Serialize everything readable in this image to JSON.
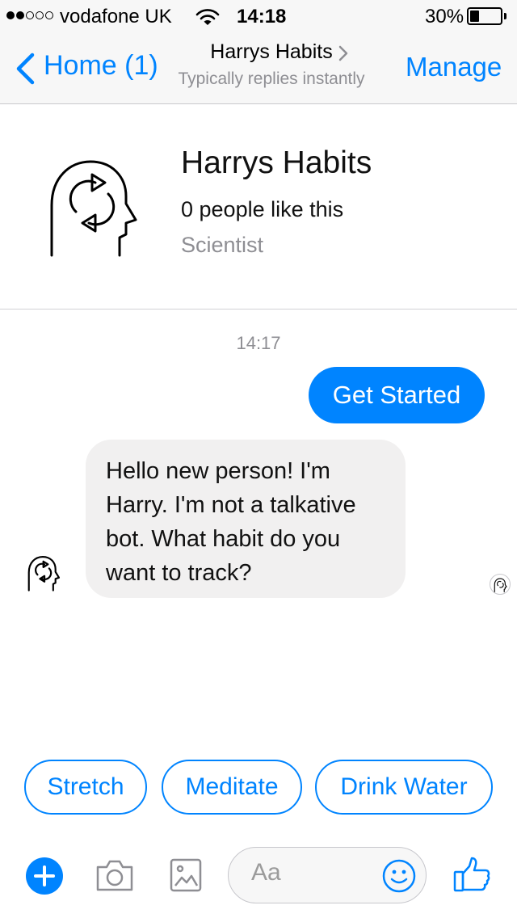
{
  "status_bar": {
    "signal_bars_filled": 2,
    "signal_bars_total": 5,
    "carrier": "vodafone UK",
    "time": "14:18",
    "battery_percent_label": "30%",
    "battery_level": 0.3
  },
  "nav": {
    "back_label": "Home (1)",
    "title": "Harrys Habits",
    "subtitle": "Typically replies instantly",
    "manage_label": "Manage"
  },
  "profile": {
    "name": "Harrys Habits",
    "likes": "0 people like this",
    "category": "Scientist"
  },
  "chat": {
    "timestamp": "14:17",
    "messages": [
      {
        "from": "user",
        "text": "Get Started"
      },
      {
        "from": "bot",
        "lines": [
          "Hello new person! I'm",
          "Harry. I'm not a talkative",
          "bot. What habit do you",
          "want to track?"
        ]
      }
    ]
  },
  "quick_replies": [
    "Stretch",
    "Meditate",
    "Drink Water"
  ],
  "composer": {
    "placeholder": "Aa",
    "icons": [
      "plus-icon",
      "camera-icon",
      "gallery-icon",
      "emoji-icon",
      "thumbs-up-icon"
    ]
  },
  "colors": {
    "accent": "#0084ff",
    "bot_bubble": "#f1f0f0",
    "bar_background": "#f7f7f7",
    "secondary_text": "#8e8e93"
  }
}
